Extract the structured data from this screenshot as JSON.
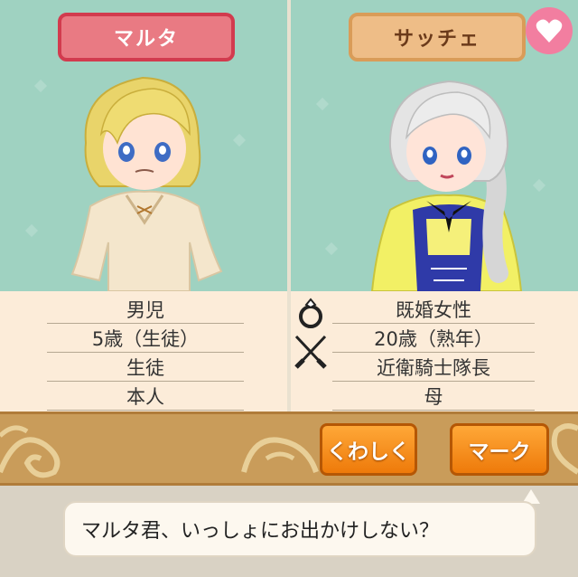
{
  "left_character": {
    "name": "マルタ",
    "info": [
      "男児",
      "5歳（生徒）",
      "生徒",
      "本人"
    ]
  },
  "right_character": {
    "name": "サッチェ",
    "info": [
      "既婚女性",
      "20歳（熟年）",
      "近衛騎士隊長",
      "母"
    ]
  },
  "icons": {
    "favorite": "heart-icon",
    "married": "ring-icon",
    "occupation": "crossed-swords-icon"
  },
  "buttons": {
    "detail_label": "くわしく",
    "mark_label": "マーク"
  },
  "dialogue": {
    "text": "マルタ君、いっしょにお出かけしない？"
  },
  "colors": {
    "panel_bg": "#9fd2c1",
    "left_tag": "#e97a83",
    "right_tag": "#eebd87",
    "button": "#f28a1e"
  }
}
